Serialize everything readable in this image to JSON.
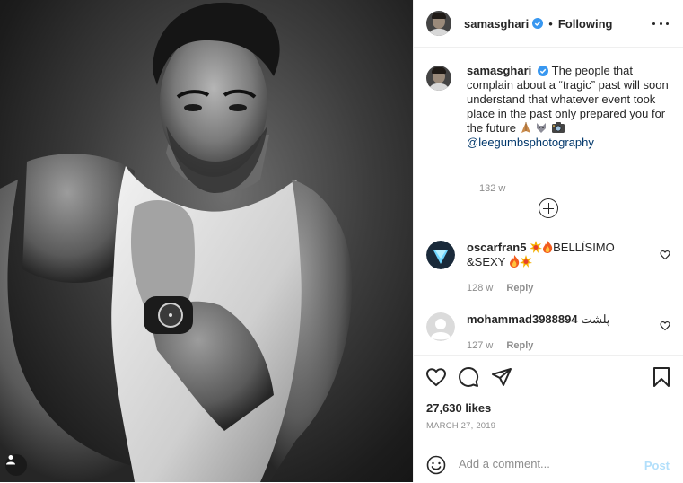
{
  "post": {
    "username": "samasghari",
    "follow_state": "Following",
    "separator": "•"
  },
  "caption": {
    "username": "samasghari",
    "text": "The people that complain about a “tragic” past will soon understand that whatever event took place in the past only prepared you for the future",
    "emojis": [
      "folded-hands-icon",
      "wolf-icon",
      "camera-icon"
    ],
    "mention": "@leegumbsphotography",
    "time": "132 w"
  },
  "comments": [
    {
      "username": "oscarfran5",
      "text": "BELLÍSIMO &SEXY",
      "time": "128 w",
      "reply_label": "Reply"
    },
    {
      "username": "mohammad3988894",
      "text": "پلشت",
      "time": "127 w",
      "reply_label": "Reply"
    }
  ],
  "stats": {
    "likes": "27,630 likes",
    "date": "MARCH 27, 2019"
  },
  "add_comment": {
    "placeholder": "Add a comment...",
    "post_label": "Post"
  },
  "colors": {
    "verified": "#3897f0",
    "link": "#00376b",
    "muted": "#8e8e8e",
    "post_disabled": "#b2dffb",
    "border": "#efefef"
  }
}
